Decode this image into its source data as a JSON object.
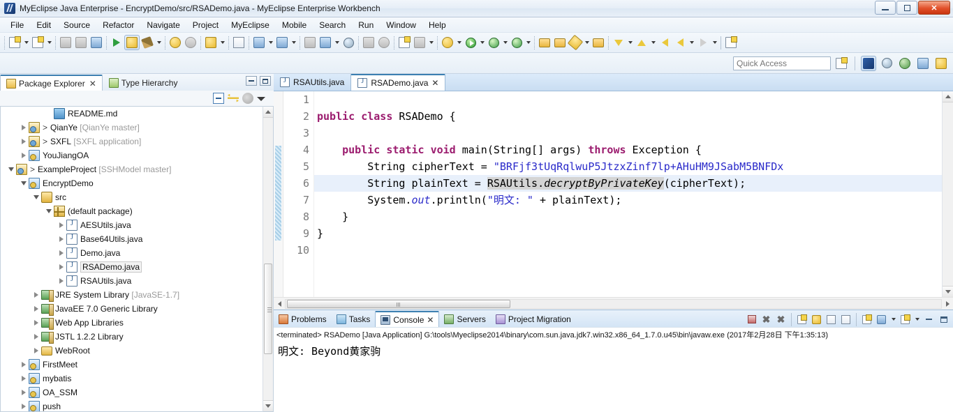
{
  "window": {
    "title": "MyEclipse Java Enterprise - EncryptDemo/src/RSADemo.java - MyEclipse Enterprise Workbench",
    "app_icon": "myeclipse-icon",
    "minimize_label": "minimize-button",
    "restore_label": "restore-button",
    "close_label": "✕"
  },
  "menubar": {
    "items": [
      {
        "label": "File"
      },
      {
        "label": "Edit"
      },
      {
        "label": "Source"
      },
      {
        "label": "Refactor"
      },
      {
        "label": "Navigate"
      },
      {
        "label": "Project"
      },
      {
        "label": "MyEclipse"
      },
      {
        "label": "Mobile"
      },
      {
        "label": "Search"
      },
      {
        "label": "Run"
      },
      {
        "label": "Window"
      },
      {
        "label": "Help"
      }
    ]
  },
  "toolbar": {
    "groups": [
      [
        "new-wizard-icon",
        "dropdown",
        "new-java-project-icon",
        "dropdown"
      ],
      [
        "save-icon",
        "save-all-icon",
        "print-icon"
      ],
      [
        "next-annotation-icon",
        "myeclipse-deploy-icon",
        "build-hammer-icon",
        "dropdown"
      ],
      [
        "undo-icon",
        "redo-icon"
      ],
      [
        "validate-icon",
        "dropdown"
      ],
      [
        "html-2-icon",
        "migrate-icon",
        "dropdown",
        "report-icon",
        "dropdown"
      ],
      [
        "export-icon",
        "run-server-icon",
        "dropdown",
        "browser-icon"
      ],
      [
        "db-browser-icon",
        "sync-icon"
      ],
      [
        "new-report-icon",
        "db-explorer-icon",
        "dropdown"
      ],
      [
        "debug-myeclipse-icon",
        "dropdown"
      ],
      [
        "run-icon",
        "dropdown",
        "run-config-icon",
        "dropdown",
        "coverage-icon",
        "dropdown"
      ],
      [
        "open-type-icon",
        "open-task-icon",
        "search-icon",
        "dropdown",
        "open-resource-icon"
      ],
      [
        "next-edit-icon",
        "dropdown",
        "prev-edit-icon",
        "dropdown",
        "back-icon",
        "forward-icon",
        "dropdown",
        "forward2-icon",
        "dropdown"
      ],
      [
        "new-window-icon"
      ]
    ]
  },
  "quick_access": {
    "placeholder": "Quick Access",
    "value": "",
    "perspective_icons": [
      "open-perspective-icon",
      "myeclipse-perspective-icon",
      "web-perspective-icon",
      "team-perspective-icon",
      "java-ee-perspective-icon",
      "debug-perspective-icon"
    ],
    "selected_perspective": "myeclipse-perspective-icon"
  },
  "left_panel": {
    "tabs": [
      {
        "label": "Package Explorer",
        "icon": "package-explorer-icon",
        "selected": true,
        "closable": true
      },
      {
        "label": "Type Hierarchy",
        "icon": "type-hierarchy-icon",
        "selected": false,
        "closable": false
      }
    ],
    "view_controls": [
      "minimize-view-button",
      "maximize-view-button"
    ],
    "tree_toolbar": [
      "collapse-all-icon",
      "link-with-editor-icon",
      "focus-icon",
      "view-menu-icon"
    ],
    "tree": [
      {
        "indent": 3,
        "twisty": "none",
        "icon": "i-md",
        "label": "README.md"
      },
      {
        "indent": 1,
        "twisty": "closed",
        "icon": "i-proj-git",
        "label": "QianYe",
        "prefix": ">",
        "dim": "[QianYe master]"
      },
      {
        "indent": 1,
        "twisty": "closed",
        "icon": "i-proj-git",
        "label": "SXFL",
        "prefix": ">",
        "dim": "[SXFL application]"
      },
      {
        "indent": 1,
        "twisty": "closed",
        "icon": "i-proj-web",
        "label": "YouJiangOA"
      },
      {
        "indent": 0,
        "twisty": "open",
        "icon": "i-proj-git",
        "label": "ExampleProject",
        "prefix": ">",
        "dim": "[SSHModel master]"
      },
      {
        "indent": 1,
        "twisty": "open",
        "icon": "i-proj-web",
        "label": "EncryptDemo"
      },
      {
        "indent": 2,
        "twisty": "open",
        "icon": "i-src",
        "label": "src"
      },
      {
        "indent": 3,
        "twisty": "open",
        "icon": "i-pkg",
        "label": "(default package)"
      },
      {
        "indent": 4,
        "twisty": "closed",
        "icon": "i-java",
        "label": "AESUtils.java"
      },
      {
        "indent": 4,
        "twisty": "closed",
        "icon": "i-java",
        "label": "Base64Utils.java"
      },
      {
        "indent": 4,
        "twisty": "closed",
        "icon": "i-java",
        "label": "Demo.java"
      },
      {
        "indent": 4,
        "twisty": "closed",
        "icon": "i-java",
        "label": "RSADemo.java",
        "selected": true
      },
      {
        "indent": 4,
        "twisty": "closed",
        "icon": "i-java",
        "label": "RSAUtils.java"
      },
      {
        "indent": 2,
        "twisty": "closed",
        "icon": "i-lib",
        "label": "JRE System Library",
        "dim": "[JavaSE-1.7]"
      },
      {
        "indent": 2,
        "twisty": "closed",
        "icon": "i-lib",
        "label": "JavaEE 7.0 Generic Library"
      },
      {
        "indent": 2,
        "twisty": "closed",
        "icon": "i-lib",
        "label": "Web App Libraries"
      },
      {
        "indent": 2,
        "twisty": "closed",
        "icon": "i-lib",
        "label": "JSTL 1.2.2 Library"
      },
      {
        "indent": 2,
        "twisty": "closed",
        "icon": "i-webroot",
        "label": "WebRoot"
      },
      {
        "indent": 1,
        "twisty": "closed",
        "icon": "i-proj-web",
        "label": "FirstMeet"
      },
      {
        "indent": 1,
        "twisty": "closed",
        "icon": "i-proj-web",
        "label": "mybatis"
      },
      {
        "indent": 1,
        "twisty": "closed",
        "icon": "i-proj-web",
        "label": "OA_SSM"
      },
      {
        "indent": 1,
        "twisty": "closed",
        "icon": "i-proj-web",
        "label": "push"
      }
    ]
  },
  "editor": {
    "tabs": [
      {
        "label": "RSAUtils.java",
        "icon": "java-file-icon",
        "selected": false,
        "closable": false
      },
      {
        "label": "RSADemo.java",
        "icon": "java-file-icon",
        "selected": true,
        "closable": true
      }
    ],
    "close_glyph": "✕",
    "lines": [
      {
        "num": "1",
        "text": "",
        "highlight": false
      },
      {
        "num": "2",
        "text": "public class RSADemo {",
        "highlight": false
      },
      {
        "num": "3",
        "text": "",
        "highlight": false
      },
      {
        "num": "4",
        "text": "    public static void main(String[] args) throws Exception {",
        "highlight": false
      },
      {
        "num": "5",
        "text": "        String cipherText = \"BRFjf3tUqRqlwuP5JtzxZinf7lp+AHuHM9JSabM5BNFDx",
        "highlight": false
      },
      {
        "num": "6",
        "text": "        String plainText = RSAUtils.decryptByPrivateKey(cipherText);",
        "highlight": true
      },
      {
        "num": "7",
        "text": "        System.out.println(\"明文: \" + plainText);",
        "highlight": false
      },
      {
        "num": "8",
        "text": "    }",
        "highlight": false
      },
      {
        "num": "9",
        "text": "}",
        "highlight": false
      },
      {
        "num": "10",
        "text": "",
        "highlight": false
      }
    ],
    "colors": {
      "keyword": "#9b1b6e",
      "string": "#2a2aca",
      "static_field": "#2a2aca",
      "current_line_bg": "#e8f0fb",
      "occurrence_bg": "#d4d4d4"
    }
  },
  "bottom_panel": {
    "tabs": [
      {
        "label": "Problems",
        "icon": "problems-icon",
        "selected": false,
        "closable": false
      },
      {
        "label": "Tasks",
        "icon": "tasks-icon",
        "selected": false,
        "closable": false
      },
      {
        "label": "Console",
        "icon": "console-icon",
        "selected": true,
        "closable": true
      },
      {
        "label": "Servers",
        "icon": "servers-icon",
        "selected": false,
        "closable": false
      },
      {
        "label": "Project Migration",
        "icon": "project-migration-icon",
        "selected": false,
        "closable": false
      }
    ],
    "close_glyph": "✕",
    "tools": [
      "terminate-icon",
      "remove-launch-icon",
      "remove-all-launches-icon",
      "clear-console-icon",
      "scroll-lock-icon",
      "word-wrap-icon",
      "pin-console-icon",
      "open-console-icon",
      "display-selected-console-icon",
      "dropdown",
      "new-console-view-icon",
      "dropdown",
      "minimize-button",
      "maximize-button"
    ],
    "console_header": "<terminated> RSADemo [Java Application] G:\\tools\\Myeclipse2014\\binary\\com.sun.java.jdk7.win32.x86_64_1.7.0.u45\\bin\\javaw.exe (2017年2月28日 下午1:35:13)",
    "console_output": "明文: Beyond黄家驹"
  }
}
